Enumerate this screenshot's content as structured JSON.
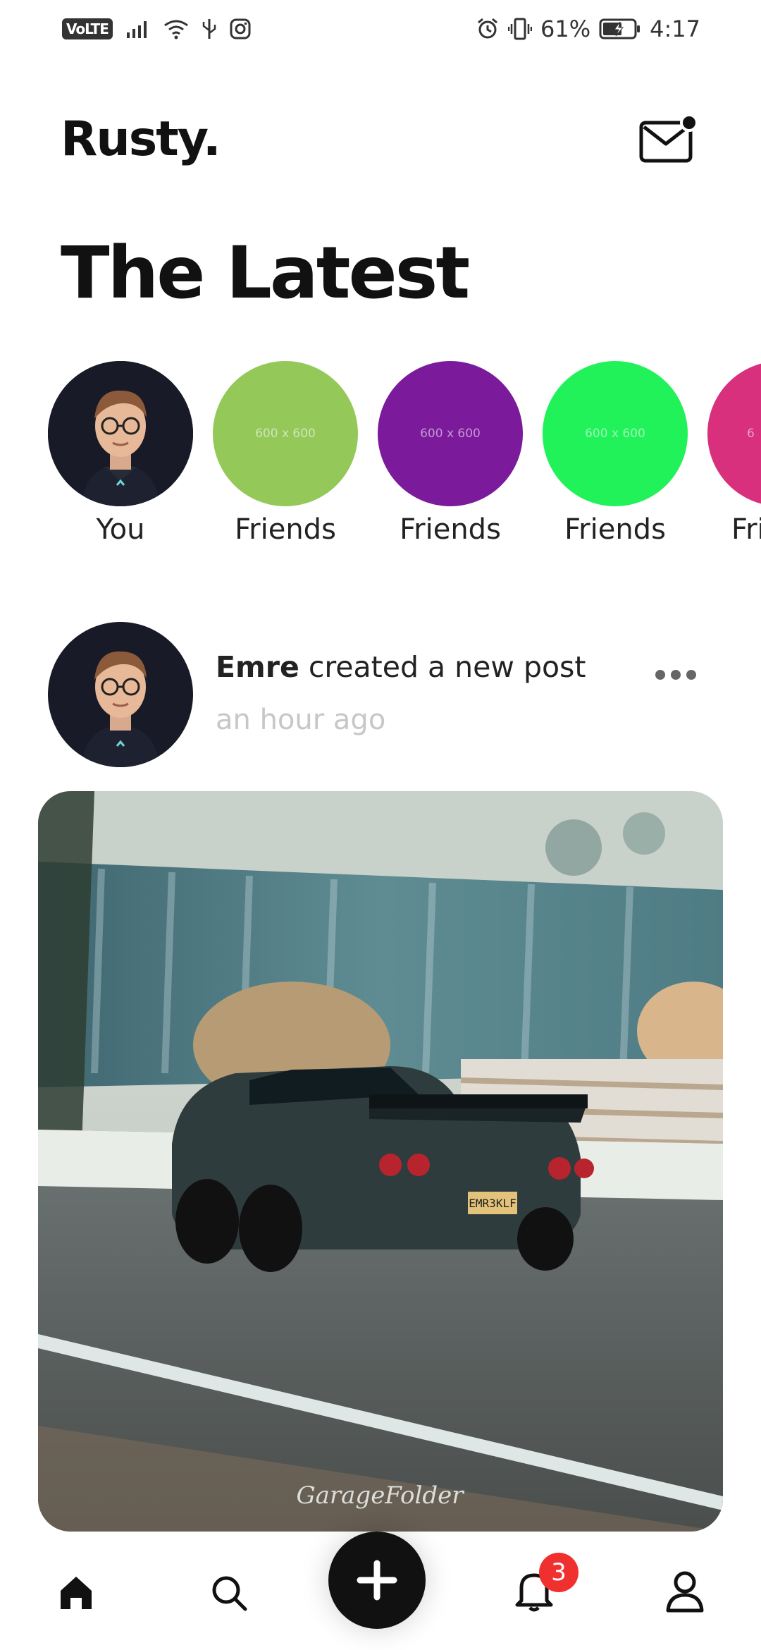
{
  "status_bar": {
    "volte": "VoLTE",
    "battery_percent": "61%",
    "time": "4:17"
  },
  "app": {
    "brand": "Rusty."
  },
  "header": {
    "title": "The Latest"
  },
  "stories": [
    {
      "label": "You",
      "color": "#1c1d2e",
      "placeholder": ""
    },
    {
      "label": "Friends",
      "color": "#94c95a",
      "placeholder": "600 x 600"
    },
    {
      "label": "Friends",
      "color": "#7b1a9b",
      "placeholder": "600 x 600"
    },
    {
      "label": "Friends",
      "color": "#22f25a",
      "placeholder": "600 x 600"
    },
    {
      "label": "Fri",
      "color": "#d8307c",
      "placeholder": "6"
    }
  ],
  "post": {
    "author": "Emre",
    "action": "created a new post",
    "time": "an hour ago",
    "plate_text": "EMR3KLF",
    "watermark": "GarageFolder"
  },
  "nav": {
    "notification_count": "3"
  },
  "colors": {
    "accent": "#111111",
    "badge": "#f0302f"
  }
}
